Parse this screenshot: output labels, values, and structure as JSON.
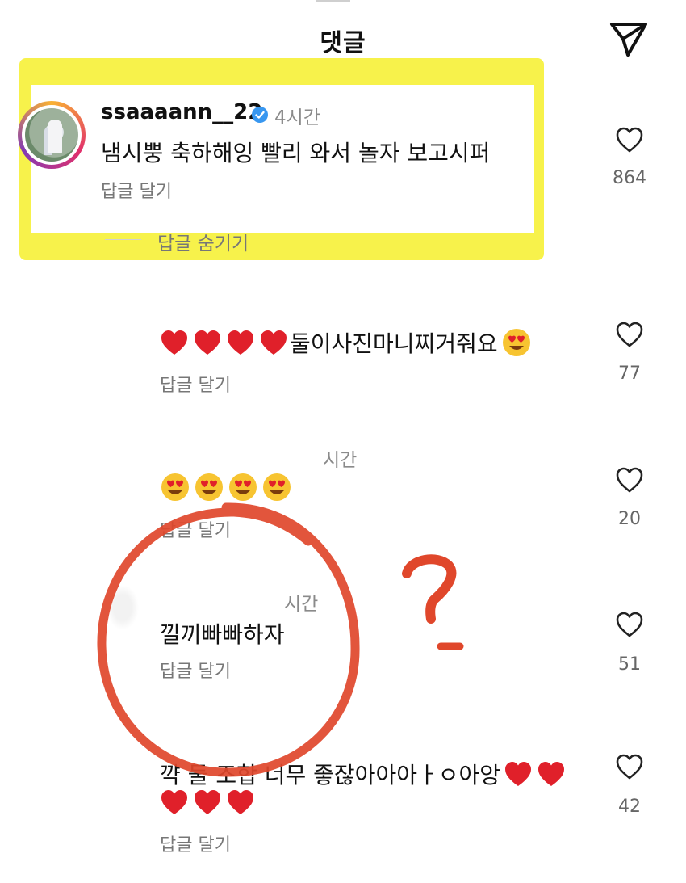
{
  "header": {
    "title": "댓글"
  },
  "highlighted_comment": {
    "username": "ssaaaann__22",
    "time": "4시간",
    "text": "냄시뿡 축하해잉 빨리 와서 놀자 보고시퍼",
    "reply_label": "답글 달기",
    "likes": "864",
    "hide_replies_label": "답글 숨기기"
  },
  "replies": [
    {
      "text": "둘이사진마니찌거줘요",
      "reply_label": "답글 달기",
      "likes": "77"
    },
    {
      "time": "시간",
      "reply_label": "답글 달기",
      "likes": "20"
    },
    {
      "time": "시간",
      "text": "낄끼빠빠하자",
      "reply_label": "답글 달기",
      "likes": "51"
    },
    {
      "text": "꺅 둘 조합 너무 좋잖아아아ㅏㅇ아앙",
      "reply_label": "답글 달기",
      "likes": "42"
    }
  ],
  "annotations": {
    "highlight_color": "#f7f24b",
    "circle_color": "#e0472b"
  },
  "icons": {
    "send": "send-icon",
    "like": "heart-outline-icon",
    "verified": "verified-badge-icon"
  }
}
